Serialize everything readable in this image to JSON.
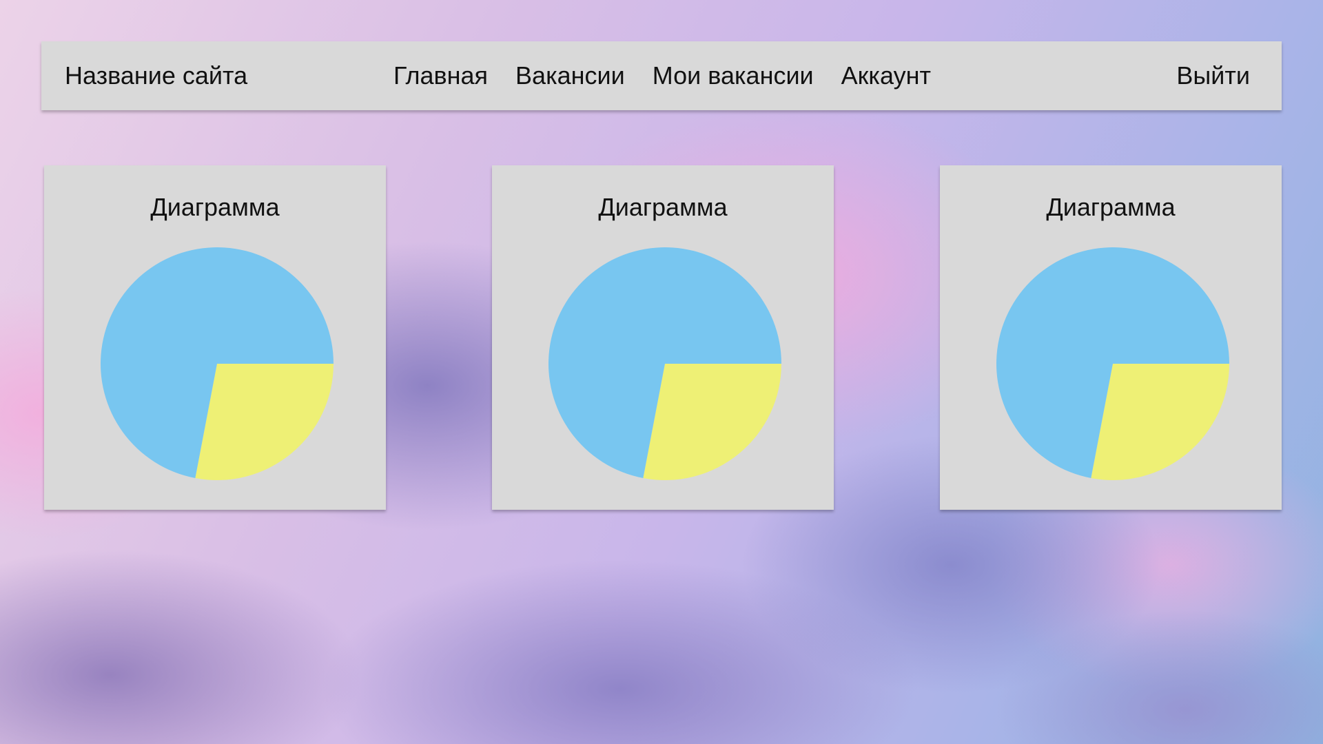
{
  "header": {
    "site_name": "Название сайта",
    "nav": [
      "Главная",
      "Вакансии",
      "Мои вакансии",
      "Аккаунт"
    ],
    "logout": "Выйти"
  },
  "cards": [
    {
      "title": "Диаграмма"
    },
    {
      "title": "Диаграмма"
    },
    {
      "title": "Диаграмма"
    }
  ],
  "chart_data": [
    {
      "type": "pie",
      "title": "Диаграмма",
      "values": [
        72,
        28
      ],
      "colors": [
        "#78c6f0",
        "#eef075"
      ]
    },
    {
      "type": "pie",
      "title": "Диаграмма",
      "values": [
        72,
        28
      ],
      "colors": [
        "#78c6f0",
        "#eef075"
      ]
    },
    {
      "type": "pie",
      "title": "Диаграмма",
      "values": [
        72,
        28
      ],
      "colors": [
        "#78c6f0",
        "#eef075"
      ]
    }
  ]
}
